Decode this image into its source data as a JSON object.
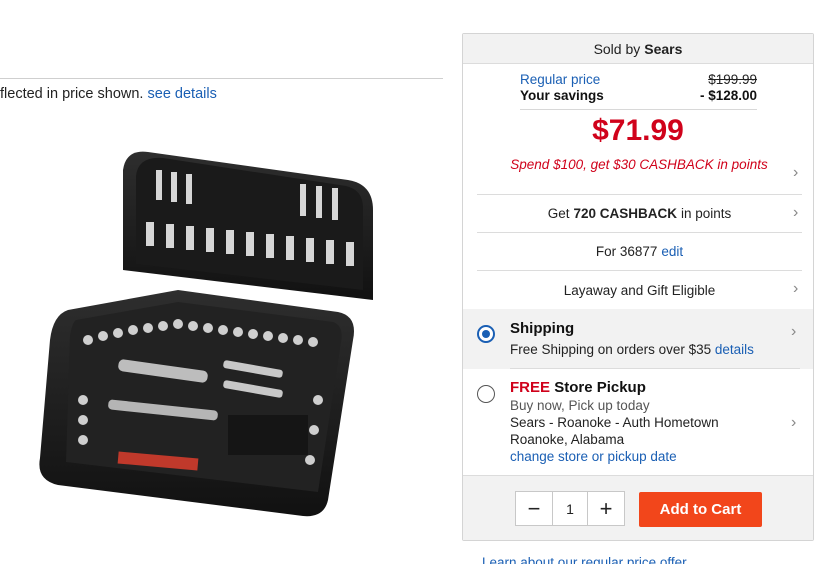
{
  "price_note": {
    "text": "flected in price shown.",
    "link": "see details"
  },
  "product": {
    "image_alt": "Mechanics tool set in black case"
  },
  "panel": {
    "sold_by_prefix": "Sold by",
    "seller": "Sears",
    "regular_price_label": "Regular price",
    "regular_price_value": "$199.99",
    "savings_label": "Your savings",
    "savings_value": "- $128.00",
    "sale_price": "$71.99",
    "cashback_promo": "Spend $100, get $30 CASHBACK in points",
    "cashback_get": "Get",
    "cashback_amount": "720 CASHBACK",
    "cashback_suffix": "in points",
    "zip_prefix": "For 36877",
    "zip_edit": "edit",
    "layaway": "Layaway and Gift Eligible"
  },
  "shipping": {
    "title": "Shipping",
    "selected": true,
    "subtitle": "Free Shipping on orders over $35",
    "details_link": "details"
  },
  "pickup": {
    "free_label": "FREE",
    "title": "Store Pickup",
    "selected": false,
    "line1": "Buy now, Pick up today",
    "store": "Sears - Roanoke - Auth Hometown",
    "city": "Roanoke, Alabama",
    "change_link": "change store or pickup date"
  },
  "cart": {
    "quantity": "1",
    "minus": "−",
    "plus": "+",
    "add_to_cart": "Add to Cart"
  },
  "learn_more": "Learn about our regular price offer",
  "icons": {
    "chevron": "chevron-right-icon",
    "minus": "minus-icon",
    "plus": "plus-icon"
  },
  "colors": {
    "accent_blue": "#1a5fb4",
    "price_red": "#d0021b",
    "cart_orange": "#f2461b"
  }
}
